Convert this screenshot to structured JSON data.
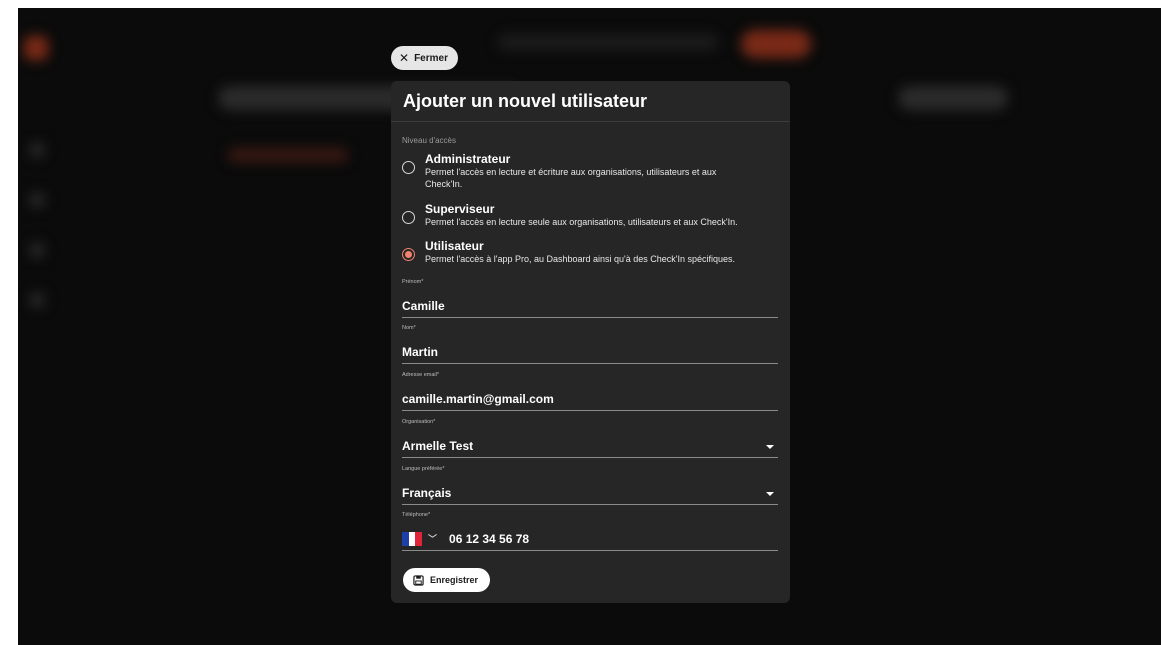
{
  "close_label": "Fermer",
  "modal": {
    "title": "Ajouter un nouvel utilisateur",
    "access_label": "Niveau d'accès",
    "roles": [
      {
        "title": "Administrateur",
        "desc_line1": "Permet l'accès en lecture et écriture aux organisations, utilisateurs et aux",
        "desc_line2": "Check'In.",
        "selected": false
      },
      {
        "title": "Superviseur",
        "desc_line1": "Permet l'accès en lecture seule aux organisations, utilisateurs et aux Check'In.",
        "selected": false
      },
      {
        "title": "Utilisateur",
        "desc_line1": "Permet l'accès à l'app Pro, au Dashboard ainsi qu'à des Check'In spécifiques.",
        "selected": true
      }
    ],
    "fields": {
      "prenom": {
        "label": "Prénom*",
        "value": "Camille"
      },
      "nom": {
        "label": "Nom*",
        "value": "Martin"
      },
      "email": {
        "label": "Adresse email*",
        "value": "camille.martin@gmail.com"
      },
      "organisation": {
        "label": "Organisation*",
        "value": "Armelle Test"
      },
      "langue": {
        "label": "Langue préférée*",
        "value": "Français"
      },
      "telephone": {
        "label": "Téléphone*",
        "value": "06 12 34 56 78"
      }
    },
    "save_label": "Enregistrer"
  },
  "colors": {
    "accent": "#f0826e",
    "modal_bg": "#262626",
    "backdrop": "#0b0b0b"
  }
}
